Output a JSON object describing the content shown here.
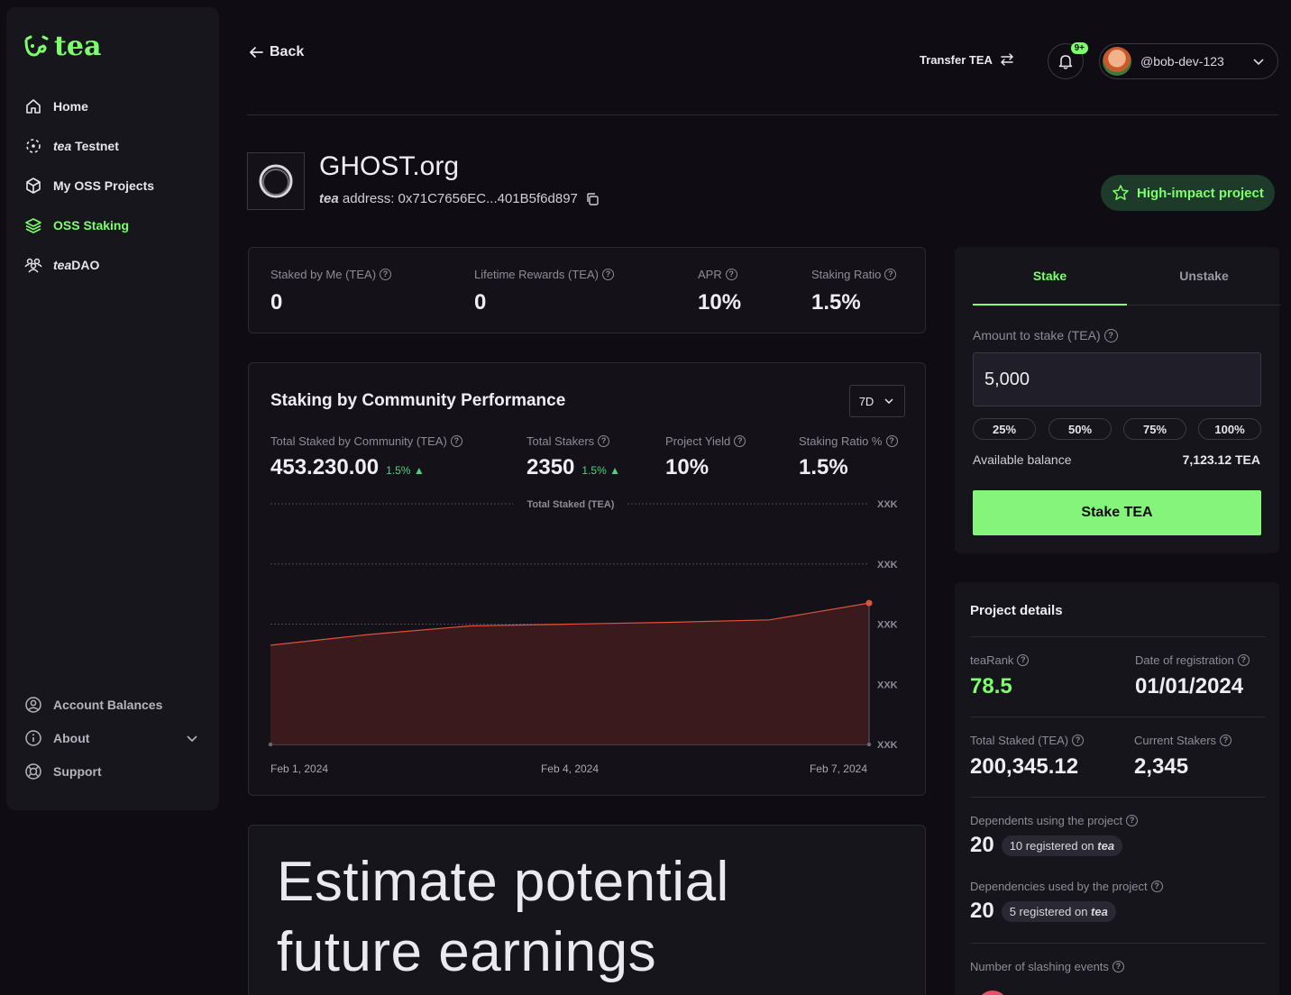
{
  "brand": {
    "name": "tea"
  },
  "sidebar": {
    "items": [
      {
        "label": "Home"
      },
      {
        "label_italic": "tea",
        "label": " Testnet"
      },
      {
        "label": "My OSS Projects"
      },
      {
        "label": "OSS Staking"
      },
      {
        "label_italic": "tea",
        "label": "DAO"
      }
    ],
    "bottom": [
      {
        "label": "Account Balances"
      },
      {
        "label": "About"
      },
      {
        "label": "Support"
      }
    ]
  },
  "header": {
    "back_label": "Back",
    "transfer_label": "Transfer TEA",
    "notif_badge": "9+",
    "username": "@bob-dev-123"
  },
  "project": {
    "name": "GHOST.org",
    "addr_prefix": "tea",
    "addr_label": " address: 0x71C7656EC...401B5f6d897",
    "badge": "High-impact project"
  },
  "my_stats": [
    {
      "label": "Staked by Me (TEA)",
      "value": "0"
    },
    {
      "label": "Lifetime Rewards (TEA)",
      "value": "0"
    },
    {
      "label": "APR",
      "value": "10%"
    },
    {
      "label": "Staking Ratio",
      "value": "1.5%"
    }
  ],
  "community": {
    "title": "Staking by Community Performance",
    "range": "7D",
    "stats": [
      {
        "label": "Total Staked by Community (TEA)",
        "value": "453.230.00",
        "delta": "1.5%"
      },
      {
        "label": "Total Stakers",
        "value": "2350",
        "delta": "1.5%"
      },
      {
        "label": "Project Yield",
        "value": "10%"
      },
      {
        "label": "Staking Ratio %",
        "value": "1.5%"
      }
    ]
  },
  "chart_data": {
    "type": "area",
    "title": "Total Staked (TEA)",
    "x": [
      "Feb 1, 2024",
      "Feb 2, 2024",
      "Feb 3, 2024",
      "Feb 4, 2024",
      "Feb 5, 2024",
      "Feb 6, 2024",
      "Feb 7, 2024"
    ],
    "x_tick_labels": [
      "Feb 1, 2024",
      "Feb 4, 2024",
      "Feb 7, 2024"
    ],
    "y_tick_labels": [
      "XXK",
      "XXK",
      "XXK",
      "XXK",
      "XXK"
    ],
    "values": [
      1.65,
      1.83,
      1.97,
      2.0,
      2.03,
      2.07,
      2.35
    ],
    "ylim": [
      0,
      4
    ],
    "color": "#e0523b",
    "grid": true
  },
  "estimate": {
    "line1": "Estimate potential",
    "line2": "future earnings"
  },
  "stake_panel": {
    "tab_stake": "Stake",
    "tab_unstake": "Unstake",
    "amount_label": "Amount to stake (TEA)",
    "amount_value": "5,000",
    "percents": [
      "25%",
      "50%",
      "75%",
      "100%"
    ],
    "available_label": "Available balance",
    "available_value": "7,123.12 TEA",
    "button": "Stake TEA"
  },
  "details": {
    "title": "Project details",
    "tearank_label": "teaRank",
    "tearank_value": "78.5",
    "reg_label": "Date of registration",
    "reg_value": "01/01/2024",
    "total_label": "Total Staked (TEA)",
    "total_value": "200,345.12",
    "stakers_label": "Current Stakers",
    "stakers_value": "2,345",
    "dependents_label": "Dependents using the project",
    "dependents_value": "20",
    "dependents_pill": "10 registered on ",
    "dependencies_label": "Dependencies used by the project",
    "dependencies_value": "20",
    "dependencies_pill": "5 registered on ",
    "pill_italic": "tea",
    "slashing_label": "Number of slashing events"
  },
  "colors": {
    "accent": "#7cff6b",
    "bg": "#0f0d13",
    "panel": "#141218",
    "chart": "#e0523b"
  }
}
